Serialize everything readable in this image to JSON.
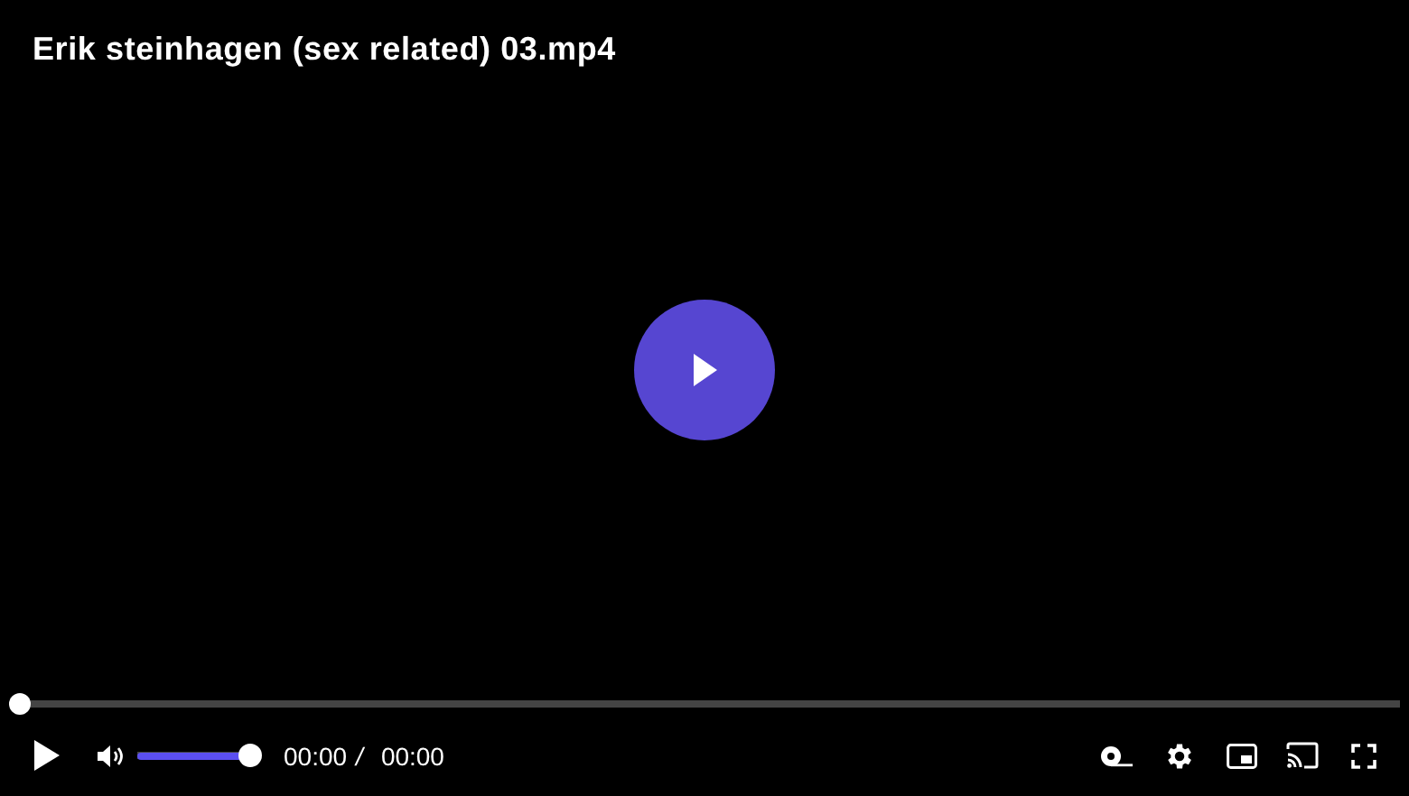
{
  "title": "Erik steinhagen (sex related) 03.mp4",
  "progress": {
    "level": 0
  },
  "volume": {
    "level": 1,
    "muted": false
  },
  "time": {
    "current": "00:00",
    "separator": "/",
    "duration": "00:00"
  },
  "playing": false
}
